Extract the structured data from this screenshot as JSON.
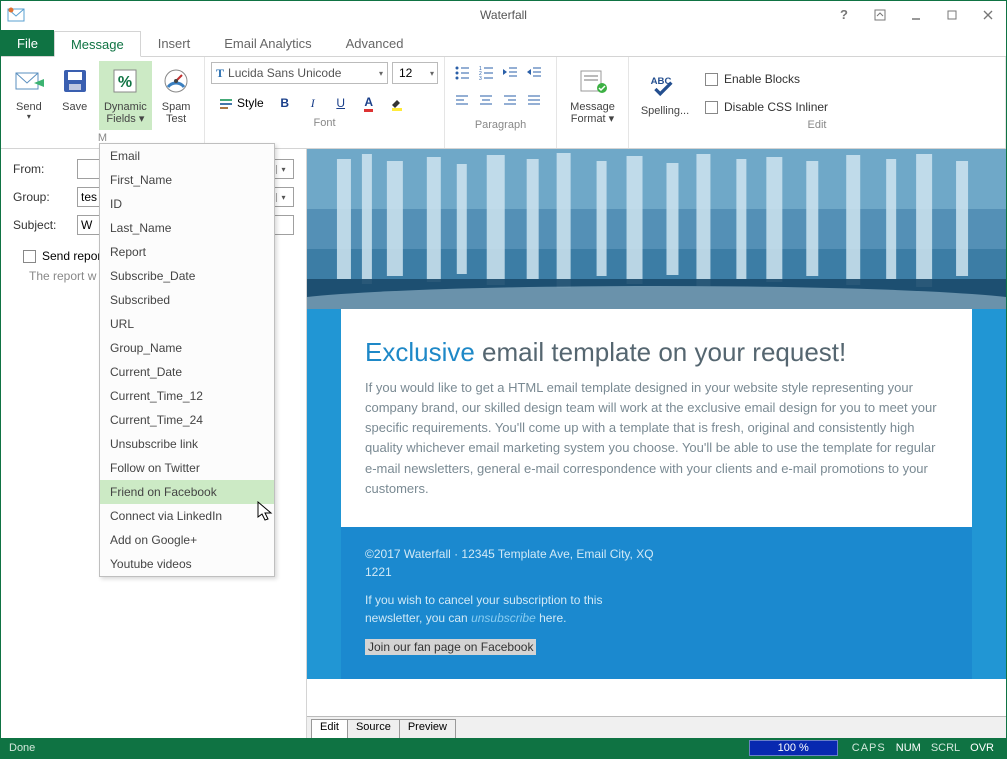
{
  "window": {
    "title": "Waterfall"
  },
  "tabs": {
    "file": "File",
    "message": "Message",
    "insert": "Insert",
    "analytics": "Email Analytics",
    "advanced": "Advanced"
  },
  "ribbon": {
    "send": "Send",
    "save": "Save",
    "dynamic": "Dynamic",
    "fields": "Fields ▾",
    "spam": "Spam",
    "test": "Test",
    "group_m": "M",
    "font_name": "Lucida Sans Unicode",
    "font_size": "12",
    "style_label": "Style",
    "group_font": "Font",
    "group_para": "Paragraph",
    "msgformat1": "Message",
    "msgformat2": "Format ▾",
    "spelling": "Spelling...",
    "enable_blocks": "Enable Blocks",
    "disable_css": "Disable CSS Inliner",
    "group_edit": "Edit"
  },
  "form": {
    "from_label": "From:",
    "group_label": "Group:",
    "subject_label": "Subject:",
    "from_value": "",
    "group_value": "tes",
    "subject_value": "W",
    "send_report_label": "Send report",
    "hint": "The report w"
  },
  "dropdown": {
    "items": [
      "Email",
      "First_Name",
      "ID",
      "Last_Name",
      "Report",
      "Subscribe_Date",
      "Subscribed",
      "URL",
      "Group_Name",
      "Current_Date",
      "Current_Time_12",
      "Current_Time_24",
      "Unsubscribe link",
      "Follow on Twitter",
      "Friend on Facebook",
      "Connect via LinkedIn",
      "Add on Google+",
      "Youtube videos"
    ],
    "hover_index": 14
  },
  "email": {
    "heading_ex": "Exclusive",
    "heading_rest": " email template on your request!",
    "para": "If you would like to get a HTML email template designed in your website style representing your company brand, our skilled design team will work at the exclusive email design for you to meet your specific requirements. You'll come up with a template that is fresh, original and consistently high quality whichever email marketing system you choose. You'll be able to use the template for regular e-mail newsletters, general e-mail correspondence with your clients and e-mail promotions to your customers.",
    "footer1": "©2017 Waterfall · 12345 Template Ave, Email City, XQ 1221",
    "footer2a": "If you wish to cancel your subscription to this newsletter, you can ",
    "footer2b": "unsubscribe",
    "footer2c": " here.",
    "fanpage": "Join our fan page on Facebook"
  },
  "viewtabs": {
    "edit": "Edit",
    "source": "Source",
    "preview": "Preview"
  },
  "status": {
    "done": "Done",
    "zoom": "100 %",
    "caps": "CAPS",
    "num": "NUM",
    "scrl": "SCRL",
    "ovr": "OVR"
  }
}
